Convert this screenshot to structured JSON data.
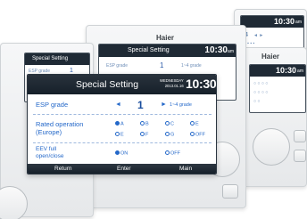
{
  "main_screen": {
    "title": "Special Setting",
    "date_line1": "WEDNESDAY",
    "date_line2": "2013.01.16",
    "time": "10:30",
    "time_suffix": "am",
    "esp": {
      "label": "ESP grade",
      "left_arrow": "◄",
      "value": "1",
      "right_arrow": "►",
      "range": "1~4 grade"
    },
    "rated": {
      "label_line1": "Rated operation",
      "label_line2": "(Europe)",
      "options": [
        "A",
        "B",
        "C",
        "E",
        "E",
        "F",
        "G",
        "OFF"
      ],
      "selected": "A"
    },
    "eev": {
      "label_line1": "EEV full",
      "label_line2": "open/close",
      "on_label": "ON",
      "off_label": "OFF",
      "selected": "ON"
    },
    "footer": {
      "return_label": "Return",
      "enter_label": "Enter",
      "main_label": "Main"
    }
  },
  "back_panels": {
    "center_logo": "Haier",
    "center_title": "Special Setting",
    "center_time": "10:30",
    "center_time_suffix": "am",
    "center_esp_label": "ESP grade",
    "center_esp_value": "1",
    "center_esp_range": "1~4 grade",
    "right_logo": "Haier",
    "right_time": "10:30",
    "right_time_suffix": "am",
    "far_right_time": "10:30",
    "far_right_time_suffix": "am",
    "left_title": "Special Setting",
    "left_esp_label": "ESP grade",
    "left_esp_value": "1"
  },
  "colors": {
    "header_bg": "#1f2a35",
    "label_blue": "#2468c9",
    "panel_bg": "#eceef0"
  }
}
